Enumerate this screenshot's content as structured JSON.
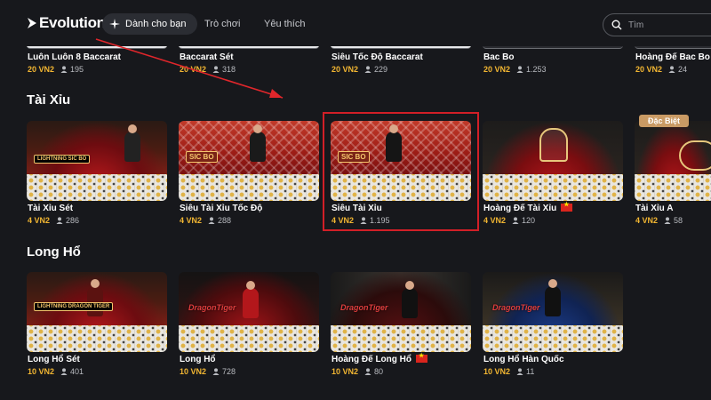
{
  "header": {
    "logo": "Evolution",
    "tabs": [
      {
        "label": "Dành cho bạn",
        "active": true
      },
      {
        "label": "Trò chơi",
        "active": false
      },
      {
        "label": "Yêu thích",
        "active": false
      }
    ],
    "search_placeholder": "Tìm"
  },
  "top_row": [
    {
      "title": "Luôn Luôn 8 Baccarat",
      "limit": "20 VN2",
      "players": "195"
    },
    {
      "title": "Baccarat Sét",
      "limit": "20 VN2",
      "players": "318"
    },
    {
      "title": "Siêu Tốc Độ Baccarat",
      "limit": "20 VN2",
      "players": "229"
    },
    {
      "title": "Bac Bo",
      "limit": "20 VN2",
      "players": "1.253"
    },
    {
      "title": "Hoàng Đế Bac Bo",
      "limit": "20 VN2",
      "players": "24",
      "flag": true
    }
  ],
  "sections": [
    {
      "title": "Tài Xỉu",
      "cards": [
        {
          "title": "Tài Xỉu Sét",
          "limit": "4 VN2",
          "players": "286",
          "badge": "LIGHTNING SIC BO"
        },
        {
          "title": "Siêu Tài Xỉu Tốc Độ",
          "limit": "4 VN2",
          "players": "288",
          "badge": "SIC BO"
        },
        {
          "title": "Siêu Tài Xỉu",
          "limit": "4 VN2",
          "players": "1.195",
          "badge": "SIC BO"
        },
        {
          "title": "Hoàng Đế Tài Xỉu",
          "limit": "4 VN2",
          "players": "120",
          "flag": true
        },
        {
          "title": "Tài Xỉu A",
          "limit": "4 VN2",
          "players": "58",
          "tag": "Đặc Biệt"
        }
      ]
    },
    {
      "title": "Long Hổ",
      "cards": [
        {
          "title": "Long Hổ Sét",
          "limit": "10 VN2",
          "players": "401",
          "badge": "LIGHTNING DRAGON TIGER"
        },
        {
          "title": "Long Hổ",
          "limit": "10 VN2",
          "players": "728",
          "badge": "DragonTiger"
        },
        {
          "title": "Hoàng Đế Long Hổ",
          "limit": "10 VN2",
          "players": "80",
          "badge": "DragonTiger",
          "flag": true
        },
        {
          "title": "Long Hổ Hàn Quốc",
          "limit": "10 VN2",
          "players": "11",
          "badge": "DragonTiger"
        }
      ]
    }
  ],
  "colors": {
    "background": "#17181c",
    "limit": "#f2b632",
    "highlight": "#d21f27",
    "annotation_arrow": "#e0262b"
  }
}
